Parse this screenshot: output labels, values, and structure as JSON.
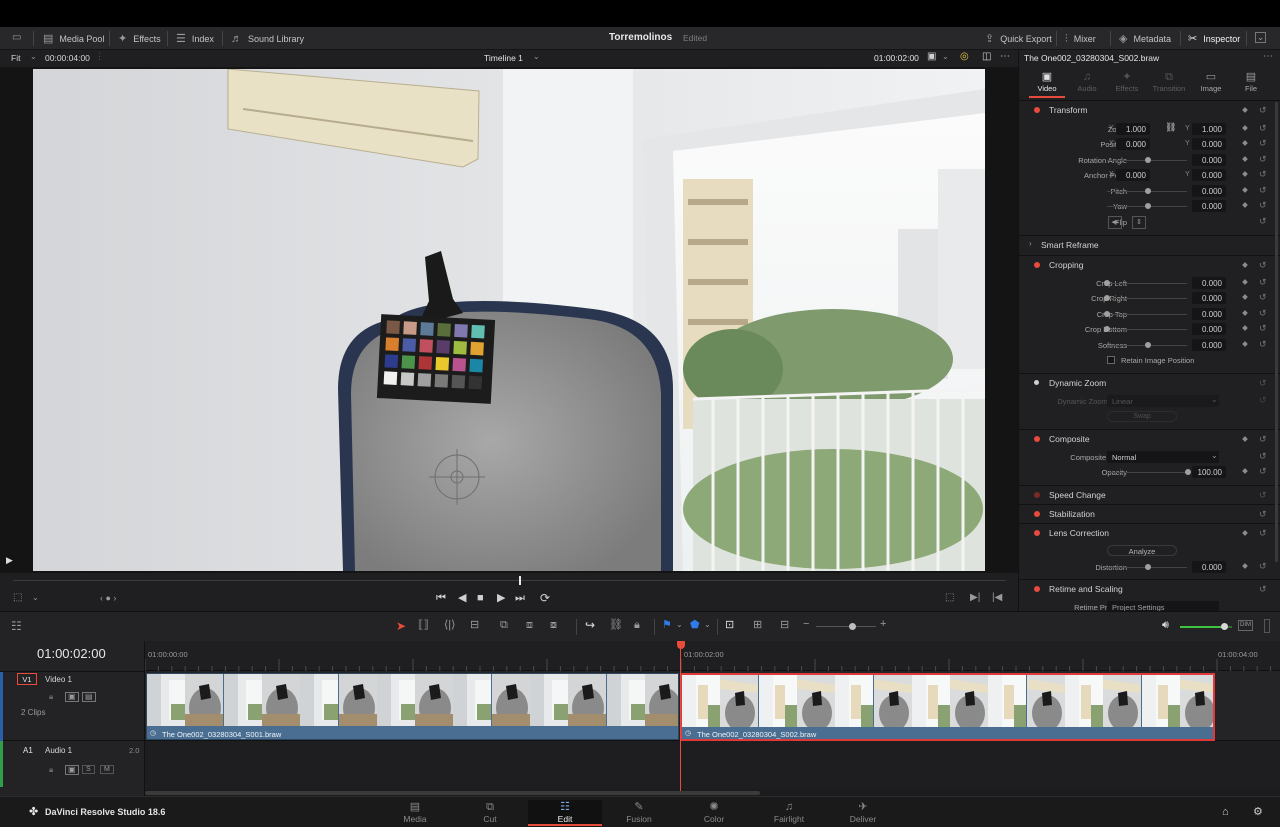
{
  "app": {
    "project_name": "Torremolinos",
    "project_status": "Edited",
    "product": "DaVinci Resolve Studio 18.6"
  },
  "topbar": {
    "left": [
      {
        "label": "Media Pool",
        "icon": "media-pool-icon"
      },
      {
        "label": "Effects",
        "icon": "effects-icon"
      },
      {
        "label": "Index",
        "icon": "index-icon"
      },
      {
        "label": "Sound Library",
        "icon": "sound-library-icon"
      }
    ],
    "right": [
      {
        "label": "Quick Export",
        "icon": "quick-export-icon"
      },
      {
        "label": "Mixer",
        "icon": "mixer-icon"
      },
      {
        "label": "Metadata",
        "icon": "metadata-icon"
      },
      {
        "label": "Inspector",
        "icon": "inspector-icon"
      }
    ]
  },
  "viewer": {
    "fit": "Fit",
    "source_timecode": "00:00:04:00",
    "timeline_name": "Timeline 1",
    "record_timecode": "01:00:02:00",
    "scrub_position": 0.51
  },
  "inspector": {
    "clip_name": "The One002_03280304_S002.braw",
    "tabs": [
      {
        "label": "Video",
        "active": true
      },
      {
        "label": "Audio",
        "active": false
      },
      {
        "label": "Effects",
        "active": false
      },
      {
        "label": "Transition",
        "active": false
      },
      {
        "label": "Image",
        "active": false
      },
      {
        "label": "File",
        "active": false
      }
    ],
    "transform": {
      "title": "Transform",
      "zoom_label": "Zoom",
      "zoom_x": "1.000",
      "zoom_y": "1.000",
      "position_label": "Position",
      "position_x": "0.000",
      "position_y": "0.000",
      "rotation_label": "Rotation Angle",
      "rotation": "0.000",
      "anchor_label": "Anchor Point",
      "anchor_x": "0.000",
      "anchor_y": "0.000",
      "pitch_label": "Pitch",
      "pitch": "0.000",
      "yaw_label": "Yaw",
      "yaw": "0.000",
      "flip_label": "Flip",
      "x": "X",
      "y": "Y"
    },
    "smart_reframe": "Smart Reframe",
    "cropping": {
      "title": "Cropping",
      "left_label": "Crop Left",
      "left": "0.000",
      "right_label": "Crop Right",
      "right": "0.000",
      "top_label": "Crop Top",
      "top": "0.000",
      "bottom_label": "Crop Bottom",
      "bottom": "0.000",
      "softness_label": "Softness",
      "softness": "0.000",
      "retain": "Retain Image Position"
    },
    "dynamic_zoom": {
      "title": "Dynamic Zoom",
      "ease_label": "Dynamic Zoom Ease",
      "ease_value": "Linear",
      "swap": "Swap"
    },
    "composite": {
      "title": "Composite",
      "mode_label": "Composite Mode",
      "mode": "Normal",
      "opacity_label": "Opacity",
      "opacity": "100.00"
    },
    "speed_change": "Speed Change",
    "stabilization": "Stabilization",
    "lens": {
      "title": "Lens Correction",
      "analyze": "Analyze",
      "distortion_label": "Distortion",
      "distortion": "0.000"
    },
    "retime": {
      "title": "Retime and Scaling",
      "process_label": "Retime Process",
      "process_value": "Project Settings"
    }
  },
  "timeline": {
    "current_timecode": "01:00:02:00",
    "ruler": [
      "01:00:00:00",
      "01:00:02:00",
      "01:00:04:00"
    ],
    "video_track": {
      "id": "V1",
      "name": "Video 1",
      "clips_count": "2 Clips"
    },
    "audio_track": {
      "id": "A1",
      "name": "Audio 1",
      "channels": "2.0",
      "s": "S",
      "m": "M"
    },
    "clips": [
      {
        "name": "The One002_03280304_S001.braw",
        "selected": false
      },
      {
        "name": "The One002_03280304_S002.braw",
        "selected": true
      }
    ],
    "zoom_level": 0.6,
    "volume_level": 0.85
  },
  "pages": [
    {
      "label": "Media",
      "icon": "media-page-icon",
      "active": false
    },
    {
      "label": "Cut",
      "icon": "cut-page-icon",
      "active": false
    },
    {
      "label": "Edit",
      "icon": "edit-page-icon",
      "active": true
    },
    {
      "label": "Fusion",
      "icon": "fusion-page-icon",
      "active": false
    },
    {
      "label": "Color",
      "icon": "color-page-icon",
      "active": false
    },
    {
      "label": "Fairlight",
      "icon": "fairlight-page-icon",
      "active": false
    },
    {
      "label": "Deliver",
      "icon": "deliver-page-icon",
      "active": false
    }
  ],
  "colors": {
    "accent": "#e64b3c",
    "clip_bar": "#4a6e91",
    "selection": "#e0393a",
    "playhead": "#e64b3c",
    "marker_blue": "#2f7be8"
  }
}
